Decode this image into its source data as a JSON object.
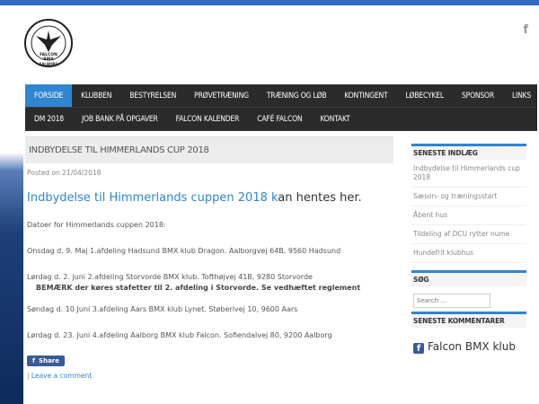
{
  "logo": {
    "text_top": "FALCON",
    "text_mid": "BMX",
    "text_bottom": "AALBORG"
  },
  "header": {
    "fb_glyph": "f"
  },
  "nav": {
    "row1": [
      "FORSIDE",
      "KLUBBEN",
      "BESTYRELSEN",
      "PRØVETRÆNING",
      "TRÆNING OG LØB",
      "KONTINGENT",
      "LØBECYKEL",
      "SPONSOR",
      "LINKS"
    ],
    "row2": [
      "DM 2018",
      "JOB BANK PÅ OPGAVER",
      "FALCON KALENDER",
      "CAFÉ FALCON",
      "KONTAKT"
    ],
    "active": "FORSIDE"
  },
  "post": {
    "title": "INDBYDELSE TIL HIMMERLANDS CUP 2018",
    "meta": "Posted on 21/04/2018",
    "headline_link": "Indbydelse til Himmerlands cuppen 2018 k",
    "headline_rest": "an hentes her.",
    "p1": "Datoer for Himmerlands cuppen 2018:",
    "p2": "Onsdag d. 9. Maj 1.afdeling Hadsund BMX klub Dragon. Aalborgvej 64B, 9560 Hadsund",
    "p3": "Lørdag d. 2. juni 2.afdeling Storvorde BMX klub. Tofthøjvej 41B, 9280 Storvorde",
    "p3b": "BEMÆRK der køres stafetter til 2. afdeling i Storvorde. Se vedhæftet reglement",
    "p4": "Søndag d. 10 Juni 3.afdeling Aars BMX klub Lynet. Støberivej 10, 9600 Aars",
    "p5": "Lørdag d. 23. Juni 4.afdeling Aalborg BMX klub Falcon. Sofiendalvej 80, 9200 Aalborg",
    "share_label": "Share",
    "leave_prefix": "| ",
    "leave_link": "Leave a comment"
  },
  "sidebar": {
    "recent_title": "SENESTE INDLÆG",
    "recent": [
      "Indbydelse til Himmerlands cup 2018",
      "Sæson- og træningsstart",
      "Åbent hus",
      "Tildeling af DCU rytter nume",
      "Hundefrit klubhus"
    ],
    "search_title": "SØG",
    "search_placeholder": "Search ...",
    "comments_title": "SENESTE KOMMENTARER",
    "fb_label": "Falcon BMX klub"
  },
  "colors": {
    "accent": "#2f86d0",
    "nav_bg": "#2b2b2b",
    "facebook": "#3b5998"
  }
}
